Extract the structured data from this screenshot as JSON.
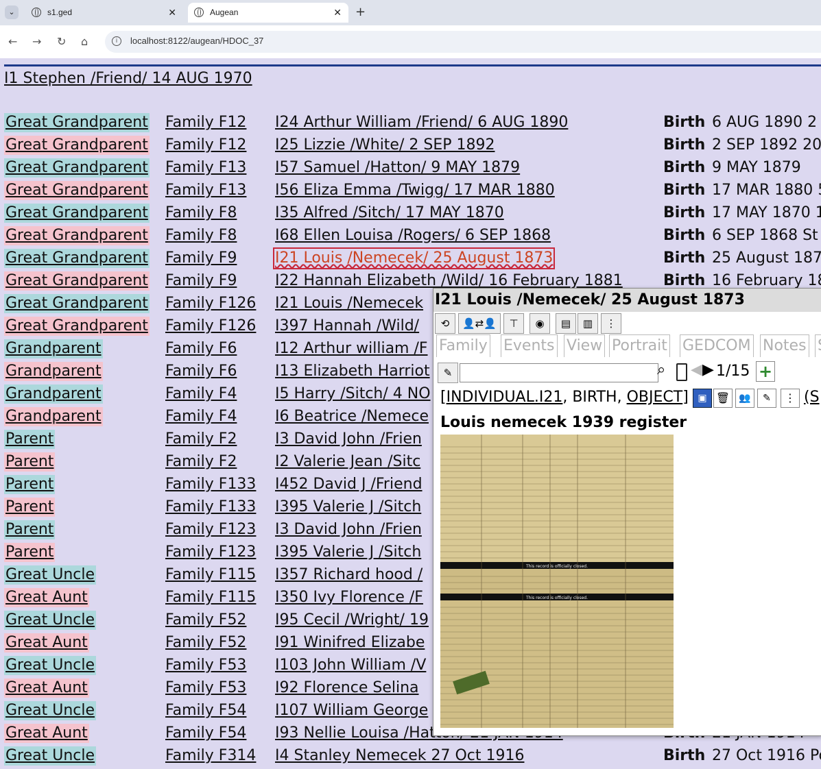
{
  "browser": {
    "tabs": [
      {
        "title": "s1.ged",
        "active": false
      },
      {
        "title": "Augean",
        "active": true
      }
    ],
    "url": "localhost:8122/augean/HDOC_37"
  },
  "page": {
    "root_person": "I1 Stephen /Friend/ 14 AUG 1970",
    "rows": [
      {
        "relation": "Great Grandparent",
        "sex": "m",
        "family": "Family F12",
        "individual": "I24 Arthur William /Friend/ 6 AUG 1890",
        "event": "Birth",
        "date": "6 AUG 1890  2"
      },
      {
        "relation": "Great Grandparent",
        "sex": "f",
        "family": "Family F12",
        "individual": "I25 Lizzie /White/ 2 SEP 1892",
        "event": "Birth",
        "date": "2 SEP 1892  20"
      },
      {
        "relation": "Great Grandparent",
        "sex": "m",
        "family": "Family F13",
        "individual": "I57 Samuel /Hatton/ 9 MAY 1879",
        "event": "Birth",
        "date": "9 MAY 1879"
      },
      {
        "relation": "Great Grandparent",
        "sex": "f",
        "family": "Family F13",
        "individual": "I56 Eliza Emma /Twigg/ 17 MAR 1880",
        "event": "Birth",
        "date": "17 MAR 1880  5"
      },
      {
        "relation": "Great Grandparent",
        "sex": "m",
        "family": "Family F8",
        "individual": "I35 Alfred /Sitch/ 17 MAY 1870",
        "event": "Birth",
        "date": "17 MAY 1870  1"
      },
      {
        "relation": "Great Grandparent",
        "sex": "f",
        "family": "Family F8",
        "individual": "I68 Ellen Louisa /Rogers/ 6 SEP 1868",
        "event": "Birth",
        "date": "6 SEP 1868  St"
      },
      {
        "relation": "Great Grandparent",
        "sex": "m",
        "family": "Family F9",
        "individual": "I21 Louis /Nemecek/ 25 August 1873",
        "event": "Birth",
        "date": "25 August 187",
        "highlight": true
      },
      {
        "relation": "Great Grandparent",
        "sex": "f",
        "family": "Family F9",
        "individual": "I22 Hannah Elizabeth /Wild/ 16 February 1881",
        "event": "Birth",
        "date": "16 February 18"
      },
      {
        "relation": "Great Grandparent",
        "sex": "m",
        "family": "Family F126",
        "individual": "I21 Louis /Nemecek",
        "event": "",
        "date": ""
      },
      {
        "relation": "Great Grandparent",
        "sex": "f",
        "family": "Family F126",
        "individual": "I397 Hannah /Wild/",
        "event": "",
        "date": ""
      },
      {
        "relation": "Grandparent",
        "sex": "m",
        "family": "Family F6",
        "individual": "I12 Arthur william /F",
        "event": "",
        "date": ""
      },
      {
        "relation": "Grandparent",
        "sex": "f",
        "family": "Family F6",
        "individual": "I13 Elizabeth Harriot",
        "event": "",
        "date": ""
      },
      {
        "relation": "Grandparent",
        "sex": "m",
        "family": "Family F4",
        "individual": "I5 Harry /Sitch/ 4 NO",
        "event": "",
        "date": ""
      },
      {
        "relation": "Grandparent",
        "sex": "f",
        "family": "Family F4",
        "individual": "I6 Beatrice /Nemece",
        "event": "",
        "date": ""
      },
      {
        "relation": "Parent",
        "sex": "m",
        "family": "Family F2",
        "individual": "I3 David John /Frien",
        "event": "",
        "date": ""
      },
      {
        "relation": "Parent",
        "sex": "f",
        "family": "Family F2",
        "individual": "I2 Valerie Jean /Sitc",
        "event": "",
        "date": ""
      },
      {
        "relation": "Parent",
        "sex": "m",
        "family": "Family F133",
        "individual": "I452 David J /Friend",
        "event": "",
        "date": ""
      },
      {
        "relation": "Parent",
        "sex": "f",
        "family": "Family F133",
        "individual": "I395 Valerie J /Sitch",
        "event": "",
        "date": ""
      },
      {
        "relation": "Parent",
        "sex": "m",
        "family": "Family F123",
        "individual": "I3 David John /Frien",
        "event": "",
        "date": ""
      },
      {
        "relation": "Parent",
        "sex": "f",
        "family": "Family F123",
        "individual": "I395 Valerie J /Sitch",
        "event": "",
        "date": ""
      },
      {
        "relation": "Great Uncle",
        "sex": "m",
        "family": "Family F115",
        "individual": "I357 Richard hood /",
        "event": "",
        "date": ""
      },
      {
        "relation": "Great Aunt",
        "sex": "f",
        "family": "Family F115",
        "individual": "I350 Ivy Florence /F",
        "event": "",
        "date": ""
      },
      {
        "relation": "Great Uncle",
        "sex": "m",
        "family": "Family F52",
        "individual": "I95 Cecil /Wright/ 19",
        "event": "",
        "date": ""
      },
      {
        "relation": "Great Aunt",
        "sex": "f",
        "family": "Family F52",
        "individual": "I91 Winifred Elizabe",
        "event": "",
        "date": ""
      },
      {
        "relation": "Great Uncle",
        "sex": "m",
        "family": "Family F53",
        "individual": "I103 John William /V",
        "event": "",
        "date": ""
      },
      {
        "relation": "Great Aunt",
        "sex": "f",
        "family": "Family F53",
        "individual": "I92 Florence Selina",
        "event": "",
        "date": ""
      },
      {
        "relation": "Great Uncle",
        "sex": "m",
        "family": "Family F54",
        "individual": "I107 William George",
        "event": "",
        "date": ""
      },
      {
        "relation": "Great Aunt",
        "sex": "f",
        "family": "Family F54",
        "individual": "I93 Nellie Louisa /Hatton/ 21 JAN 1914",
        "event": "Birth",
        "date": "21 JAN 1914"
      },
      {
        "relation": "Great Uncle",
        "sex": "m",
        "family": "Family F314",
        "individual": "I4 Stanley Nemecek 27 Oct 1916",
        "event": "Birth",
        "date": "27 Oct 1916  Po"
      }
    ]
  },
  "popup": {
    "title": "I21 Louis /Nemecek/ 25 August 1873",
    "tabs": [
      "Family",
      "Events",
      "View",
      "Portrait",
      "GEDCOM",
      "Notes",
      "S"
    ],
    "search_value": "",
    "counter": "1/15",
    "ref_open": "[",
    "ref_individual": "INDIVIDUAL.I21",
    "ref_sep1": ", BIRTH, ",
    "ref_object": "OBJECT",
    "ref_close": "]",
    "ref_trailing": "(S",
    "object_title": "Louis nemecek 1939 register",
    "image_caption_lines": [
      "This record is officially closed.",
      "This record is officially closed."
    ]
  }
}
